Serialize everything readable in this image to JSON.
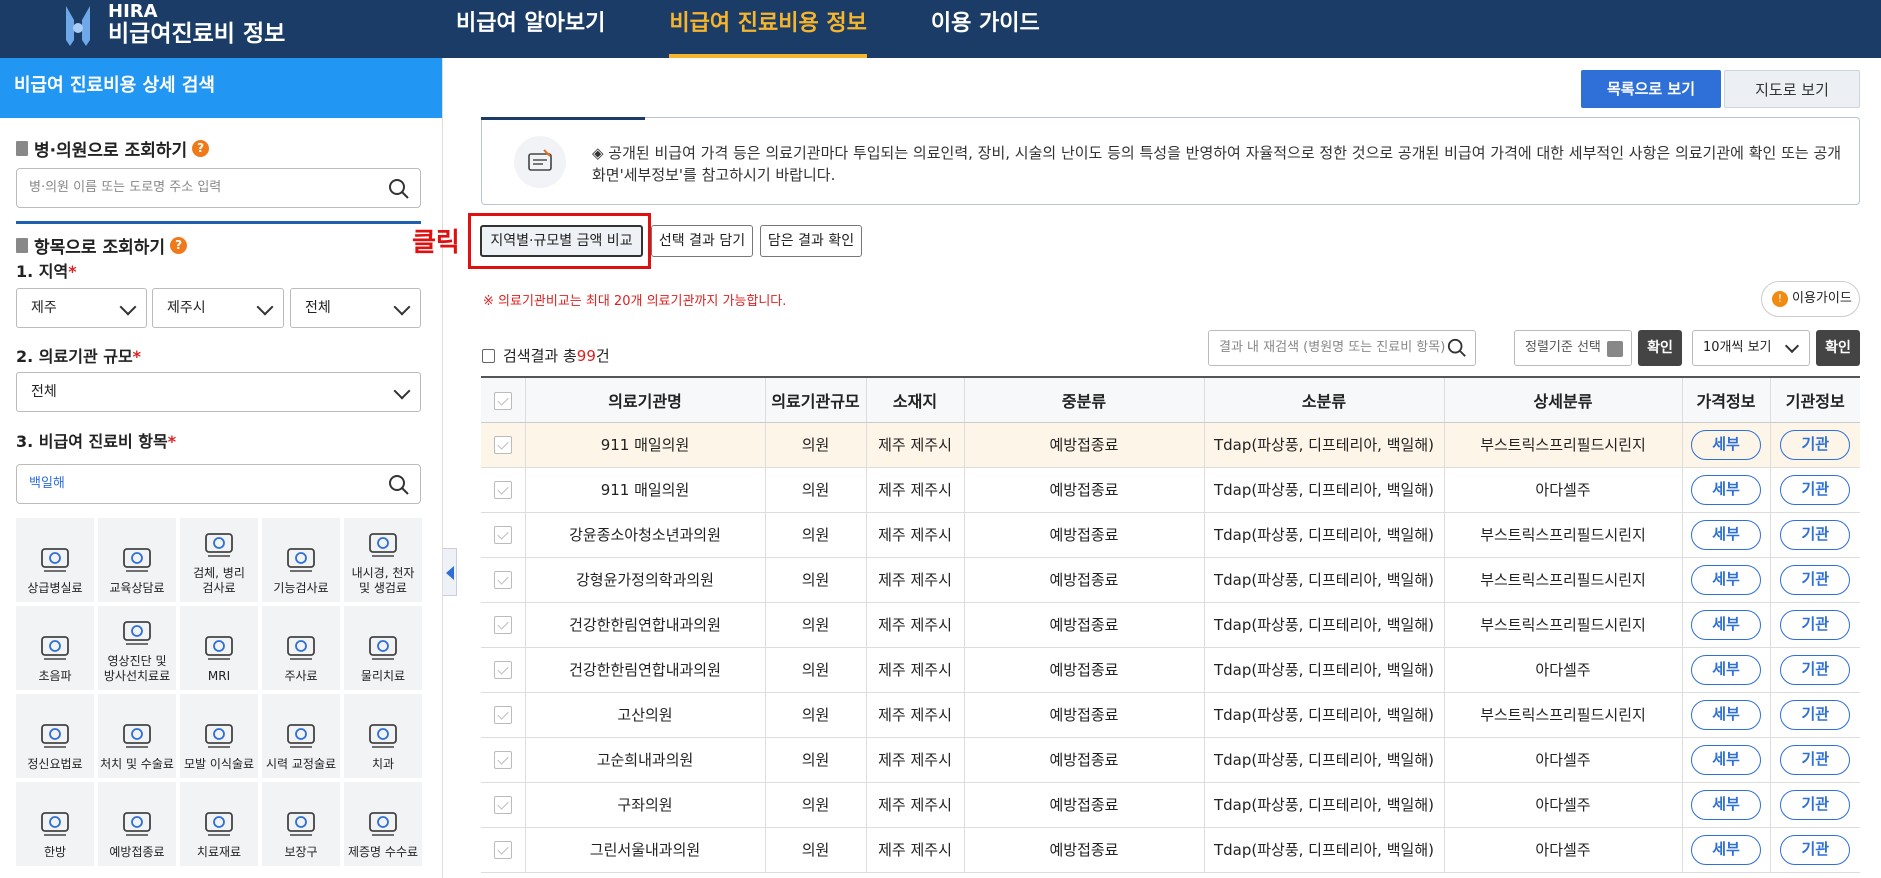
{
  "header": {
    "logo_top": "HIRA",
    "logo_bottom": "비급여진료비 정보",
    "nav": [
      "비급여 알아보기",
      "비급여 진료비용 정보",
      "이용 가이드"
    ],
    "active_nav": "비급여 진료비용 정보",
    "bg_color": "#1b3c66",
    "accent_color": "#f7b52c"
  },
  "sidebar": {
    "title": "비급여 진료비용 상세 검색",
    "hospital_search": {
      "title": "병·의원으로 조회하기",
      "placeholder": "병·의원 이름 또는 도로명 주소 입력"
    },
    "item_search": {
      "title": "항목으로 조회하기",
      "region_label": "1. 지역",
      "region_values": [
        "제주",
        "제주시",
        "전체"
      ],
      "scale_label": "2. 의료기관 규모",
      "scale_value": "전체",
      "item_label": "3. 비급여 진료비 항목",
      "item_value": "백일해"
    },
    "categories": [
      {
        "label": "상급병실료",
        "icon": "bed-icon"
      },
      {
        "label": "교육상담료",
        "icon": "consult-icon"
      },
      {
        "label": "검체, 병리\n검사료",
        "icon": "microscope-icon"
      },
      {
        "label": "기능검사료",
        "icon": "function-test-icon"
      },
      {
        "label": "내시경, 천자\n및 생검료",
        "icon": "endoscope-icon"
      },
      {
        "label": "초음파",
        "icon": "ultrasound-icon"
      },
      {
        "label": "영상진단 및\n방사선치료료",
        "icon": "xray-icon"
      },
      {
        "label": "MRI",
        "icon": "mri-icon"
      },
      {
        "label": "주사료",
        "icon": "syringe-icon"
      },
      {
        "label": "물리치료",
        "icon": "physio-icon"
      },
      {
        "label": "정신요법료",
        "icon": "brain-wave-icon"
      },
      {
        "label": "처치 및 수술료",
        "icon": "scalpel-icon"
      },
      {
        "label": "모발 이식술료",
        "icon": "hair-icon"
      },
      {
        "label": "시력 교정술료",
        "icon": "eye-icon"
      },
      {
        "label": "치과",
        "icon": "tooth-icon"
      },
      {
        "label": "한방",
        "icon": "ear-acupuncture-icon"
      },
      {
        "label": "예방접종료",
        "icon": "vaccine-icon"
      },
      {
        "label": "치료재료",
        "icon": "material-icon"
      },
      {
        "label": "보장구",
        "icon": "wheelchair-icon"
      },
      {
        "label": "제증명 수수료",
        "icon": "certificate-icon"
      }
    ]
  },
  "main": {
    "view_buttons": [
      "목록으로 보기",
      "지도로 보기"
    ],
    "notice": "◈ 공개된 비급여 가격 등은 의료기관마다 투입되는 의료인력, 장비, 시술의 난이도 등의 특성을 반영하여 자율적으로 정한 것으로 공개된 비급여 가격에 대한 세부적인 사항은 의료기관에 확인 또는 공개화면'세부정보'를 참고하시기 바랍니다.",
    "click_annotation": "클릭",
    "tool_buttons": [
      "지역별·규모별 금액 비교",
      "선택 결과 담기",
      "담은 결과 확인"
    ],
    "warning": "※ 의료기관비교는 최대 20개 의료기관까지 가능합니다.",
    "guide_button": "이용가이드",
    "result_prefix": "검색결과 총",
    "result_count": "99",
    "result_suffix": "건",
    "in_search_placeholder": "결과 내 재검색 (병원명 또는 진료비 항목)",
    "sort_label": "정렬기준 선택",
    "confirm_label": "확인",
    "per_page": "10개씩 보기",
    "table": {
      "headers": [
        "의료기관명",
        "의료기관규모",
        "소재지",
        "중분류",
        "소분류",
        "상세분류",
        "가격정보",
        "기관정보"
      ],
      "detail_label": "세부",
      "inst_label": "기관",
      "rows": [
        [
          "911 매일의원",
          "의원",
          "제주 제주시",
          "예방접종료",
          "Tdap(파상풍, 디프테리아, 백일해)",
          "부스트릭스프리필드시린지"
        ],
        [
          "911 매일의원",
          "의원",
          "제주 제주시",
          "예방접종료",
          "Tdap(파상풍, 디프테리아, 백일해)",
          "아다셀주"
        ],
        [
          "강윤종소아청소년과의원",
          "의원",
          "제주 제주시",
          "예방접종료",
          "Tdap(파상풍, 디프테리아, 백일해)",
          "부스트릭스프리필드시린지"
        ],
        [
          "강형윤가정의학과의원",
          "의원",
          "제주 제주시",
          "예방접종료",
          "Tdap(파상풍, 디프테리아, 백일해)",
          "부스트릭스프리필드시린지"
        ],
        [
          "건강한한림연합내과의원",
          "의원",
          "제주 제주시",
          "예방접종료",
          "Tdap(파상풍, 디프테리아, 백일해)",
          "부스트릭스프리필드시린지"
        ],
        [
          "건강한한림연합내과의원",
          "의원",
          "제주 제주시",
          "예방접종료",
          "Tdap(파상풍, 디프테리아, 백일해)",
          "아다셀주"
        ],
        [
          "고산의원",
          "의원",
          "제주 제주시",
          "예방접종료",
          "Tdap(파상풍, 디프테리아, 백일해)",
          "부스트릭스프리필드시린지"
        ],
        [
          "고순희내과의원",
          "의원",
          "제주 제주시",
          "예방접종료",
          "Tdap(파상풍, 디프테리아, 백일해)",
          "아다셀주"
        ],
        [
          "구좌의원",
          "의원",
          "제주 제주시",
          "예방접종료",
          "Tdap(파상풍, 디프테리아, 백일해)",
          "아다셀주"
        ],
        [
          "그린서울내과의원",
          "의원",
          "제주 제주시",
          "예방접종료",
          "Tdap(파상풍, 디프테리아, 백일해)",
          "아다셀주"
        ]
      ]
    }
  }
}
